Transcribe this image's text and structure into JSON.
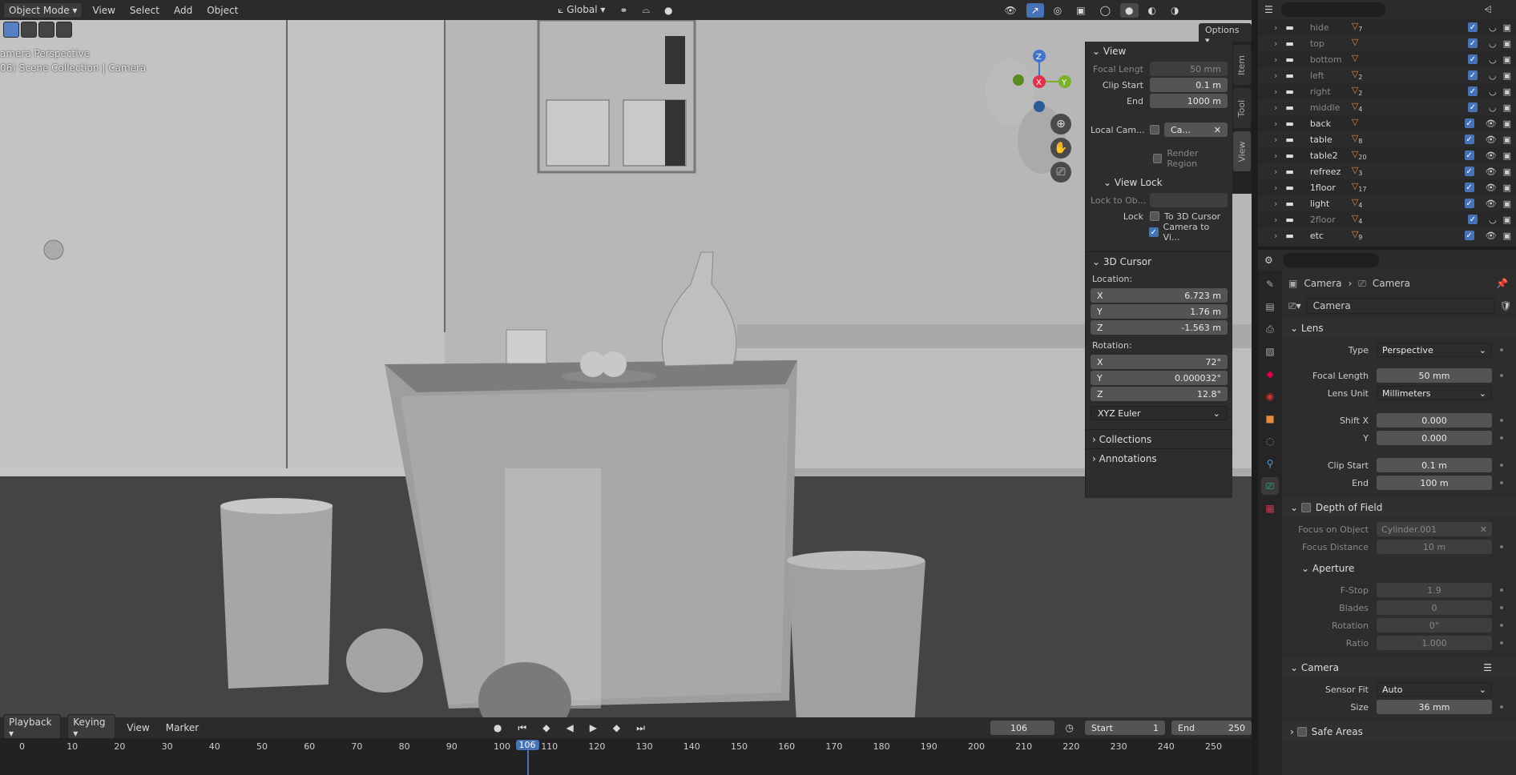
{
  "header": {
    "mode": "Object Mode",
    "menus": [
      "View",
      "Select",
      "Add",
      "Object"
    ],
    "orientation": "Global",
    "options_label": "Options"
  },
  "viewport": {
    "overlay_line1": "amera Perspective",
    "overlay_line2": "06) Scene Collection | Camera",
    "gizmo": {
      "z": "Z",
      "x": "X",
      "y": "Y"
    }
  },
  "npanel": {
    "tabs": [
      "Item",
      "Tool",
      "View"
    ],
    "view_title": "View",
    "focal_length_label": "Focal Lengt",
    "focal_length": "50 mm",
    "clip_start_label": "Clip Start",
    "clip_start": "0.1 m",
    "end_label": "End",
    "end": "1000 m",
    "local_camera_label": "Local Cam...",
    "local_camera_value": "Ca...",
    "render_region": "Render Region",
    "view_lock_title": "View Lock",
    "lock_to_object_label": "Lock to Ob...",
    "lock_label": "Lock",
    "to_3d_cursor": "To 3D Cursor",
    "camera_to_view": "Camera to Vi...",
    "cursor_title": "3D Cursor",
    "location_label": "Location:",
    "loc_x": "6.723 m",
    "loc_y": "1.76 m",
    "loc_z": "-1.563 m",
    "rotation_label": "Rotation:",
    "rot_x": "72°",
    "rot_y": "0.000032°",
    "rot_z": "12.8°",
    "rotation_mode": "XYZ Euler",
    "axis_x": "X",
    "axis_y": "Y",
    "axis_z": "Z",
    "collections": "Collections",
    "annotations": "Annotations"
  },
  "timeline": {
    "menus": [
      "Playback",
      "Keying",
      "View",
      "Marker"
    ],
    "current_frame": "106",
    "start_label": "Start",
    "start": "1",
    "end_label": "End",
    "end": "250",
    "ticks": [
      "0",
      "10",
      "20",
      "30",
      "40",
      "50",
      "60",
      "70",
      "80",
      "90",
      "100",
      "110",
      "120",
      "130",
      "140",
      "150",
      "160",
      "170",
      "180",
      "190",
      "200",
      "210",
      "220",
      "230",
      "240",
      "250"
    ],
    "playhead_label": "106"
  },
  "outliner": {
    "rows": [
      {
        "name": "hide",
        "count": "7"
      },
      {
        "name": "top",
        "count": ""
      },
      {
        "name": "bottom",
        "count": ""
      },
      {
        "name": "left",
        "count": "2"
      },
      {
        "name": "right",
        "count": "2"
      },
      {
        "name": "middle",
        "count": "4"
      },
      {
        "name": "back",
        "count": ""
      },
      {
        "name": "table",
        "count": "8"
      },
      {
        "name": "table2",
        "count": "20"
      },
      {
        "name": "refreez",
        "count": "3"
      },
      {
        "name": "1floor",
        "count": "17"
      },
      {
        "name": "light",
        "count": "4"
      },
      {
        "name": "2floor",
        "count": "4"
      },
      {
        "name": "etc",
        "count": "9"
      }
    ]
  },
  "properties": {
    "breadcrumb_obj": "Camera",
    "breadcrumb_data": "Camera",
    "datablock": "Camera",
    "lens_title": "Lens",
    "type_label": "Type",
    "type_value": "Perspective",
    "focal_label": "Focal Length",
    "focal_value": "50 mm",
    "lens_unit_label": "Lens Unit",
    "lens_unit_value": "Millimeters",
    "shift_x_label": "Shift X",
    "shift_x": "0.000",
    "shift_y_label": "Y",
    "shift_y": "0.000",
    "clip_start_label": "Clip Start",
    "clip_start": "0.1 m",
    "clip_end_label": "End",
    "clip_end": "100 m",
    "dof_title": "Depth of Field",
    "focus_obj_label": "Focus on Object",
    "focus_obj": "Cylinder.001",
    "focus_dist_label": "Focus Distance",
    "focus_dist": "10 m",
    "aperture_title": "Aperture",
    "fstop_label": "F-Stop",
    "fstop": "1.9",
    "blades_label": "Blades",
    "blades": "0",
    "rotation_label": "Rotation",
    "rotation": "0°",
    "ratio_label": "Ratio",
    "ratio": "1.000",
    "camera_title": "Camera",
    "sensor_fit_label": "Sensor Fit",
    "sensor_fit": "Auto",
    "size_label": "Size",
    "size": "36 mm",
    "safe_areas": "Safe Areas"
  },
  "colors": {
    "accent": "#4772b3",
    "object_orange": "#e5893a",
    "camera_green": "#2fb5a0"
  }
}
